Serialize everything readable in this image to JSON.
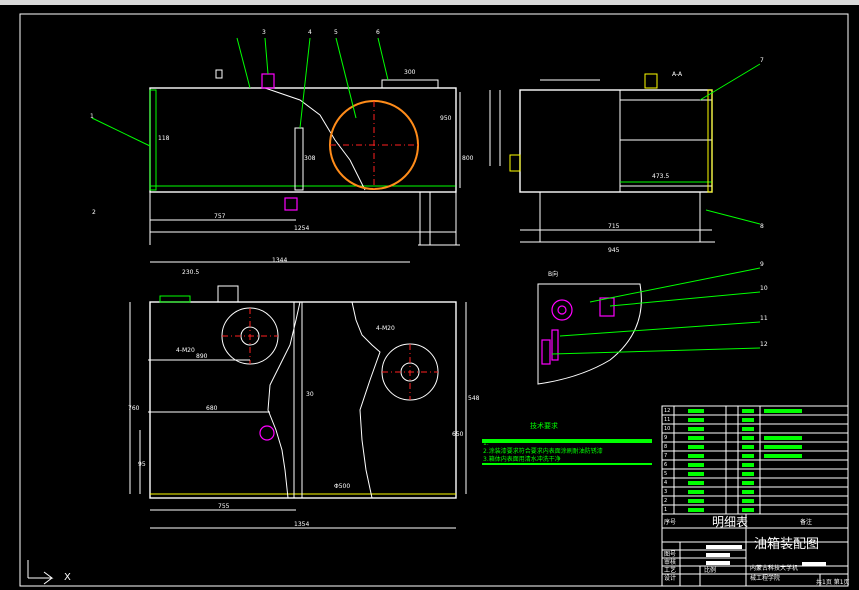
{
  "topbar": {
    "label": ""
  },
  "balloons": [
    "1",
    "2",
    "3",
    "4",
    "5",
    "6",
    "7",
    "8",
    "9",
    "10",
    "11",
    "12"
  ],
  "section_label": "A-A",
  "detail_label": "B向",
  "tech_title": "技术要求",
  "tech_lines": [
    "1.",
    "2.涂装漆要求符合要求内表面涂刷耐油防锈漆",
    "3.箱体内表面用清水冲洗干净"
  ],
  "dims": {
    "left_757": "757",
    "left_1254": "1254",
    "left_800": "800",
    "left_308": "308",
    "left_118": "118",
    "left_950": "950",
    "right_715": "715",
    "right_945": "945",
    "right_473": "473.5",
    "top_1344": "1344",
    "top_230": "230.5",
    "top_300": "300",
    "bottom_755": "755",
    "bottom_1354": "1354",
    "bottom_680": "680",
    "bottom_890": "890",
    "bottom_hole1": "4-M20",
    "bottom_hole2": "4-M20",
    "bottom_760": "760",
    "bottom_95": "95",
    "bottom_548": "548",
    "bottom_650": "650",
    "bottom_30": "30",
    "bottom_phi": "Φ500"
  },
  "bom": {
    "header_title": "明细表",
    "header_left": "序号",
    "header_right": "备注",
    "row_nums": [
      "12",
      "11",
      "10",
      "9",
      "8",
      "7",
      "6",
      "5",
      "4",
      "3",
      "2",
      "1"
    ]
  },
  "title_block": {
    "drawing_name": "油箱装配图",
    "school": "内蒙古科技大学机",
    "dept": "械工程学院",
    "rows": [
      "图号",
      "审核",
      "工艺",
      "设计"
    ],
    "scale_label": "比例",
    "sheet": "共1页 第1页"
  },
  "axis_marker": "X"
}
